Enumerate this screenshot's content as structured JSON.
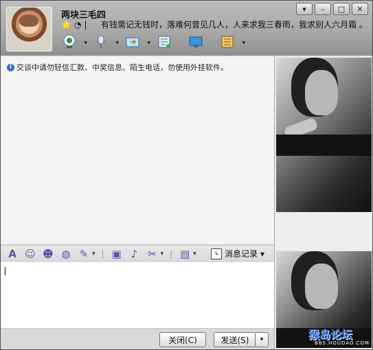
{
  "header": {
    "name": "两块三毛四",
    "signature": "有钱需记无钱时，落难何曾见几人，人来求我三春雨，我求别人六月霜 。"
  },
  "window_controls": {
    "menu": "▾",
    "minimize": "–",
    "maximize": "□",
    "close": "✕"
  },
  "toolbar": {
    "icons": [
      "webcam-icon",
      "microphone-icon",
      "folder-send-icon",
      "list-icon",
      "remote-desktop-icon",
      "app-box-icon"
    ]
  },
  "notice": {
    "text": "交谈中请勿轻信汇款、中奖信息、陌生电话，勿使用外挂软件。"
  },
  "compose": {
    "message_history_label": "消息记录"
  },
  "footer": {
    "close_label": "关闭(C)",
    "send_label": "发送(S)",
    "send_dropdown": "▾"
  },
  "watermark": {
    "text": "猴岛论坛",
    "sub": "BBS.HOUDAO.COM"
  },
  "colors": {
    "header_bg": "#a9a9a9",
    "panel_bg": "#f4f4f4",
    "accent_icon": "#5f4fa7"
  }
}
